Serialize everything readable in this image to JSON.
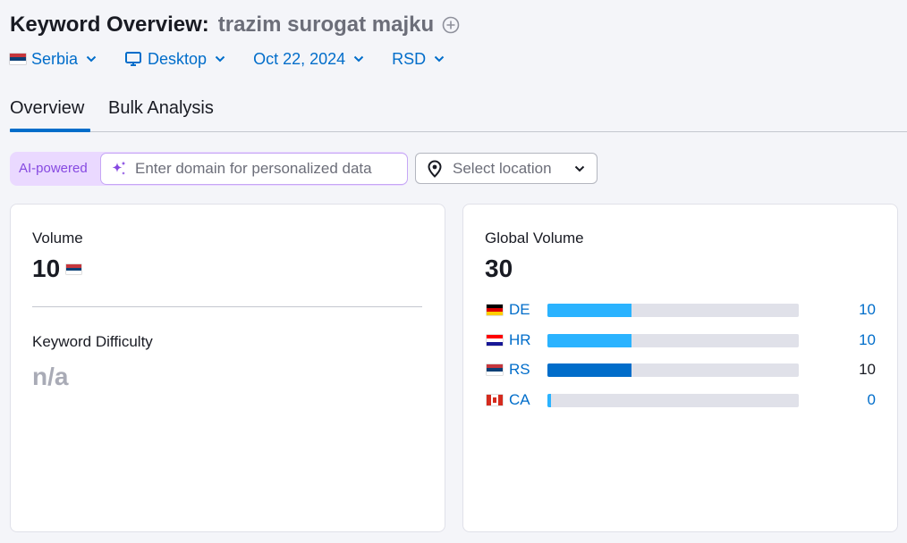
{
  "header": {
    "title_label": "Keyword Overview:",
    "keyword": "trazim surogat majku"
  },
  "filters": {
    "database": "Serbia",
    "device": "Desktop",
    "date": "Oct 22, 2024",
    "currency": "RSD"
  },
  "tabs": [
    {
      "label": "Overview",
      "active": true
    },
    {
      "label": "Bulk Analysis",
      "active": false
    }
  ],
  "ai": {
    "badge": "AI-powered",
    "placeholder": "Enter domain for personalized data"
  },
  "location": {
    "placeholder": "Select location"
  },
  "volume_card": {
    "volume_label": "Volume",
    "volume_value": "10",
    "kd_label": "Keyword Difficulty",
    "kd_value": "n/a"
  },
  "global_card": {
    "label": "Global Volume",
    "value": "30",
    "countries": [
      {
        "code": "DE",
        "value": "10",
        "share": 0.333,
        "selected": false
      },
      {
        "code": "HR",
        "value": "10",
        "share": 0.333,
        "selected": false
      },
      {
        "code": "RS",
        "value": "10",
        "share": 0.333,
        "selected": true
      },
      {
        "code": "CA",
        "value": "0",
        "share": 0.0,
        "selected": false
      }
    ]
  },
  "colors": {
    "accent": "#006dca",
    "bar": "#2bb3ff",
    "ai_purple": "#8649e1"
  }
}
